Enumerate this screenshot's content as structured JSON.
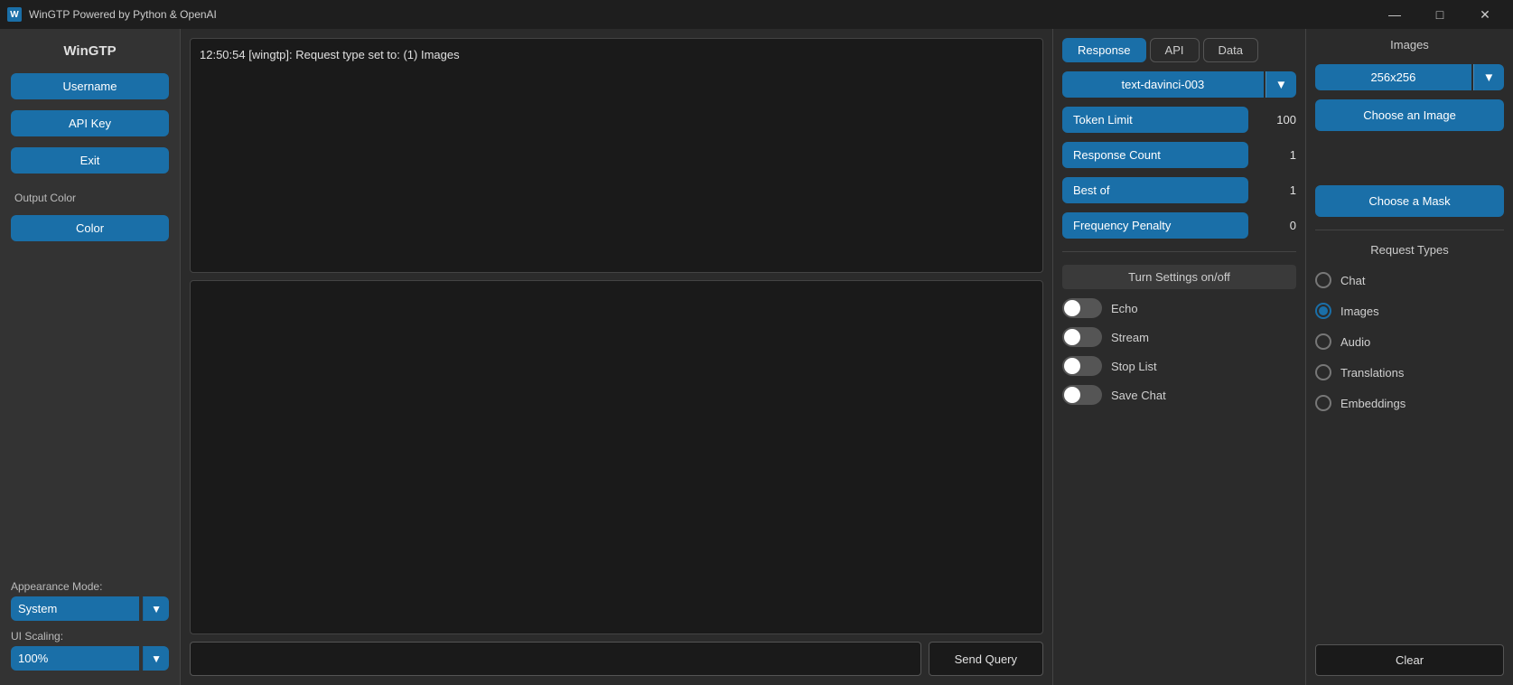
{
  "titlebar": {
    "icon": "W",
    "title": "WinGTP Powered by Python & OpenAI",
    "minimize": "—",
    "maximize": "□",
    "close": "✕"
  },
  "sidebar": {
    "app_name": "WinGTP",
    "username_btn": "Username",
    "apikey_btn": "API Key",
    "exit_btn": "Exit",
    "output_color_label": "Output Color",
    "color_btn": "Color",
    "appearance_label": "Appearance Mode:",
    "appearance_value": "System",
    "scaling_label": "UI Scaling:",
    "scaling_value": "100%"
  },
  "output": {
    "message": "12:50:54 [wingtp]: Request type set to: (1) Images"
  },
  "bottom_bar": {
    "send_label": "Send Query",
    "clear_label": "Clear"
  },
  "settings": {
    "tabs": [
      "Response",
      "API",
      "Data"
    ],
    "active_tab": "Response",
    "model": "text-davinci-003",
    "token_limit_label": "Token Limit",
    "token_limit_value": "100",
    "response_count_label": "Response Count",
    "response_count_value": "1",
    "best_of_label": "Best of",
    "best_of_value": "1",
    "frequency_penalty_label": "Frequency Penalty",
    "frequency_penalty_value": "0",
    "turn_settings_label": "Turn Settings on/off",
    "toggles": [
      {
        "label": "Echo",
        "on": false
      },
      {
        "label": "Stream",
        "on": false
      },
      {
        "label": "Stop List",
        "on": false
      },
      {
        "label": "Save Chat",
        "on": false
      }
    ]
  },
  "right_panel": {
    "images_title": "Images",
    "size_value": "256x256",
    "choose_image_label": "Choose an Image",
    "choose_mask_label": "Choose a Mask",
    "request_types_title": "Request Types",
    "request_types": [
      {
        "label": "Chat",
        "selected": false
      },
      {
        "label": "Images",
        "selected": true
      },
      {
        "label": "Audio",
        "selected": false
      },
      {
        "label": "Translations",
        "selected": false
      },
      {
        "label": "Embeddings",
        "selected": false
      }
    ],
    "clear_label": "Clear"
  }
}
